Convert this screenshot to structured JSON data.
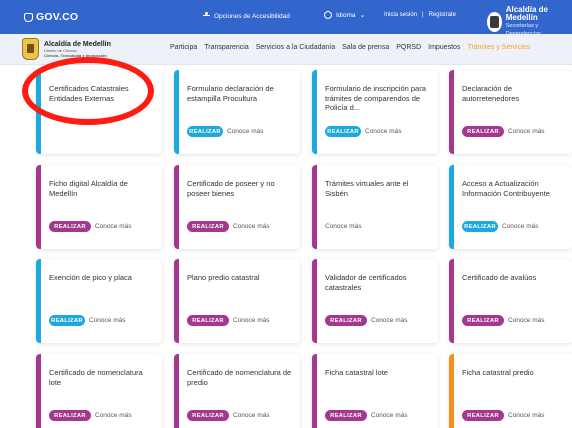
{
  "govbar": {
    "logo": "GOV.CO",
    "accessibility": "Opciones de Accesibilidad",
    "language": "Idioma",
    "login": "Inicia sesión",
    "separator": "|",
    "register": "Registrate",
    "entity_name": "Alcaldía de Medellín",
    "entity_sub": "Secretarías y Dependencias"
  },
  "nav": {
    "brand_title": "Alcaldía de Medellín",
    "brand_sub1": "Distrito de Ciencia,",
    "brand_sub2": "Ciencia, Tecnología e Innovación",
    "items": [
      {
        "label": "Participa"
      },
      {
        "label": "Transparencia"
      },
      {
        "label": "Servicios a la Ciudadanía"
      },
      {
        "label": "Sala de prensa"
      },
      {
        "label": "PQRSD"
      },
      {
        "label": "Impuestos"
      },
      {
        "label": "Trámites y Servicios"
      }
    ]
  },
  "colors": {
    "gov_blue": "#3366cc",
    "blue": "#1da9df",
    "purple": "#a4388f",
    "orange": "#f4901e",
    "active_nav": "#f0a12b",
    "annotation": "#ff1a12"
  },
  "cards": [
    {
      "title": "Certificados Catastrales Entidades Externas",
      "button": "",
      "more": "",
      "stripe": "blue"
    },
    {
      "title": "Formulario declaración de estampilla Procultura",
      "button": "REALIZAR",
      "more": "Conoce más",
      "stripe": "blue"
    },
    {
      "title": "Formulario de inscripción para trámites de comparendos de Policía d...",
      "button": "REALIZAR",
      "more": "Conoce más",
      "stripe": "blue"
    },
    {
      "title": "Declaración de autorretenedores",
      "button": "REALIZAR",
      "more": "Conoce más",
      "stripe": "purple"
    },
    {
      "title": "Ficho digital Alcaldía de Medellín",
      "button": "REALIZAR",
      "more": "Conoce más",
      "stripe": "purple"
    },
    {
      "title": "Certificado de poseer y no poseer bienes",
      "button": "REALIZAR",
      "more": "Conoce más",
      "stripe": "purple"
    },
    {
      "title": "Trámites virtuales ante el Sisbén",
      "button": "",
      "more": "Conoce más",
      "stripe": "purple"
    },
    {
      "title": "Acceso a Actualización Información Contribuyente",
      "button": "REALIZAR",
      "more": "Conoce más",
      "stripe": "blue"
    },
    {
      "title": "Exención de pico y placa",
      "button": "REALIZAR",
      "more": "Conoce más",
      "stripe": "blue"
    },
    {
      "title": "Plano predio catastral",
      "button": "REALIZAR",
      "more": "Conoce más",
      "stripe": "purple"
    },
    {
      "title": "Validador de certificados catastrales",
      "button": "REALIZAR",
      "more": "Conoce más",
      "stripe": "purple"
    },
    {
      "title": "Certificado de avalúos",
      "button": "REALIZAR",
      "more": "Conoce más",
      "stripe": "purple"
    },
    {
      "title": "Certificado de nomenclatura lote",
      "button": "REALIZAR",
      "more": "Conoce más",
      "stripe": "purple"
    },
    {
      "title": "Certificado de nomenclatura de predio",
      "button": "REALIZAR",
      "more": "Conoce más",
      "stripe": "purple"
    },
    {
      "title": "Ficha catastral lote",
      "button": "REALIZAR",
      "more": "Conoce más",
      "stripe": "purple"
    },
    {
      "title": "Ficha catastral predio",
      "button": "REALIZAR",
      "more": "Conoce más",
      "stripe": "orange"
    }
  ]
}
